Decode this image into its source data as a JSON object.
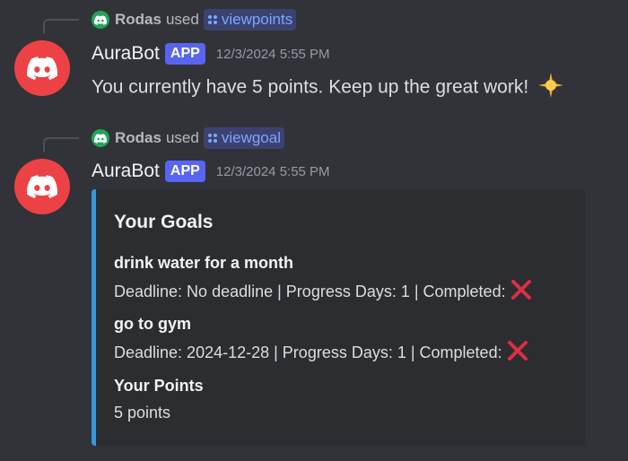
{
  "messages": [
    {
      "reply": {
        "user": "Rodas",
        "verb": "used",
        "command": "viewpoints"
      },
      "author": "AuraBot",
      "tag": "APP",
      "timestamp": "12/3/2024 5:55 PM",
      "text": "You currently have 5 points. Keep up the great work!",
      "emoji_icon": "glowing-star-icon"
    },
    {
      "reply": {
        "user": "Rodas",
        "verb": "used",
        "command": "viewgoal"
      },
      "author": "AuraBot",
      "tag": "APP",
      "timestamp": "12/3/2024 5:55 PM",
      "embed": {
        "title": "Your Goals",
        "accent_color": "#3498db",
        "fields": [
          {
            "name": "drink water for a month",
            "value": "Deadline: No deadline | Progress Days: 1 | Completed:",
            "status_icon": "cross-mark-icon"
          },
          {
            "name": "go to gym",
            "value": "Deadline: 2024-12-28 | Progress Days: 1 | Completed:",
            "status_icon": "cross-mark-icon"
          },
          {
            "name": "Your Points",
            "value": "5 points"
          }
        ]
      }
    }
  ],
  "colors": {
    "background": "#313338",
    "app_tag": "#5865f2",
    "avatar": "#ed4245",
    "command_text": "#7aa7ff",
    "cross": "#dd2e44"
  }
}
